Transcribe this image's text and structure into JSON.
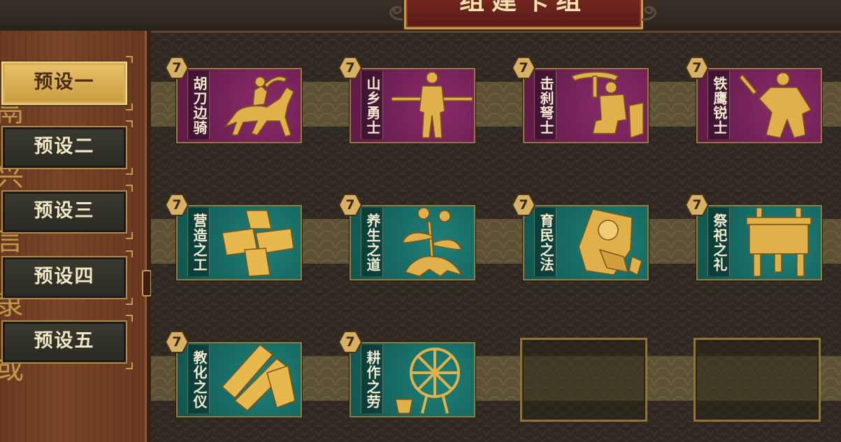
{
  "header": {
    "title": "组建卡组"
  },
  "sidebar": {
    "decor_glyphs": [
      "鬲",
      "兴",
      "言",
      "隶",
      "或"
    ],
    "presets": [
      {
        "label": "预设一",
        "active": true
      },
      {
        "label": "预设二",
        "active": false
      },
      {
        "label": "预设三",
        "active": false
      },
      {
        "label": "预设四",
        "active": false
      },
      {
        "label": "预设五",
        "active": false
      }
    ]
  },
  "cards": [
    {
      "name": "胡刀边骑",
      "cost": "7",
      "color": "purple",
      "icon": "horse-rider-icon"
    },
    {
      "name": "山乡勇士",
      "cost": "7",
      "color": "purple",
      "icon": "spear-warrior-icon"
    },
    {
      "name": "击刹弩士",
      "cost": "7",
      "color": "purple",
      "icon": "crossbowman-icon"
    },
    {
      "name": "铁鹰锐士",
      "cost": "7",
      "color": "purple",
      "icon": "sword-warrior-icon"
    },
    {
      "name": "营造之工",
      "cost": "7",
      "color": "teal",
      "icon": "timber-blocks-icon"
    },
    {
      "name": "养生之道",
      "cost": "7",
      "color": "teal",
      "icon": "herb-plant-icon"
    },
    {
      "name": "育民之法",
      "cost": "7",
      "color": "teal",
      "icon": "swaddled-baby-icon"
    },
    {
      "name": "祭祀之礼",
      "cost": "7",
      "color": "teal",
      "icon": "bronze-ding-icon"
    },
    {
      "name": "教化之仪",
      "cost": "7",
      "color": "teal",
      "icon": "bamboo-scrolls-icon"
    },
    {
      "name": "耕作之劳",
      "cost": "7",
      "color": "teal",
      "icon": "waterwheel-icon"
    }
  ],
  "empty_slots": 2,
  "colors": {
    "accent_gold": "#c99b49",
    "purple_card": "#7a2460",
    "teal_card": "#1a6f68",
    "title_red": "#6a2018"
  }
}
